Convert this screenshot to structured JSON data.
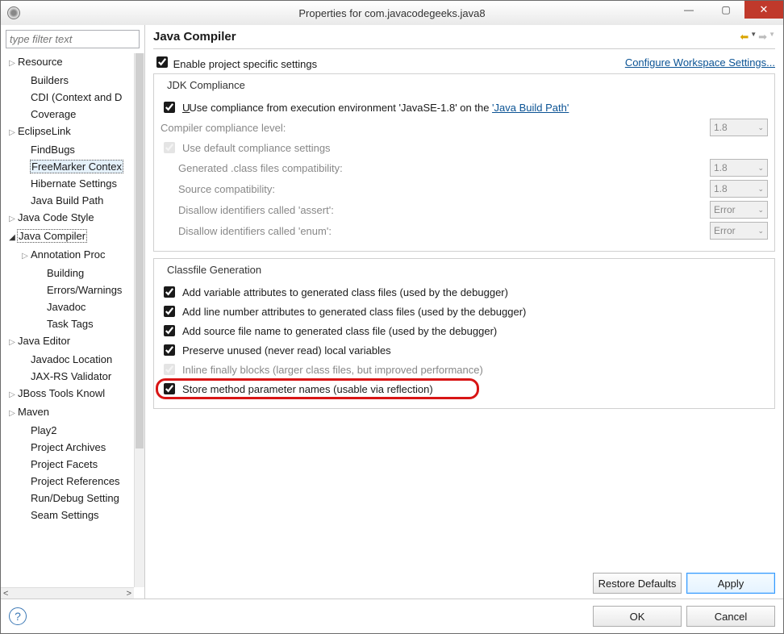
{
  "window": {
    "title": "Properties for com.javacodegeeks.java8"
  },
  "sidebar": {
    "filter_placeholder": "type filter text",
    "nodes": [
      {
        "label": "Resource",
        "depth": 0,
        "exp": ">"
      },
      {
        "label": "Builders",
        "depth": 1,
        "exp": ""
      },
      {
        "label": "CDI (Context and D",
        "depth": 1,
        "exp": ""
      },
      {
        "label": "Coverage",
        "depth": 1,
        "exp": ""
      },
      {
        "label": "EclipseLink",
        "depth": 0,
        "exp": ">"
      },
      {
        "label": "FindBugs",
        "depth": 1,
        "exp": ""
      },
      {
        "label": "FreeMarker Contex",
        "depth": 1,
        "exp": "",
        "selected": true
      },
      {
        "label": "Hibernate Settings",
        "depth": 1,
        "exp": ""
      },
      {
        "label": "Java Build Path",
        "depth": 1,
        "exp": ""
      },
      {
        "label": "Java Code Style",
        "depth": 0,
        "exp": ">"
      },
      {
        "label": "Java Compiler",
        "depth": 0,
        "exp": "⊿",
        "active": true
      },
      {
        "label": "Annotation Proc",
        "depth": 1,
        "exp": ">"
      },
      {
        "label": "Building",
        "depth": 2,
        "exp": ""
      },
      {
        "label": "Errors/Warnings",
        "depth": 2,
        "exp": ""
      },
      {
        "label": "Javadoc",
        "depth": 2,
        "exp": ""
      },
      {
        "label": "Task Tags",
        "depth": 2,
        "exp": ""
      },
      {
        "label": "Java Editor",
        "depth": 0,
        "exp": ">"
      },
      {
        "label": "Javadoc Location",
        "depth": 1,
        "exp": ""
      },
      {
        "label": "JAX-RS Validator",
        "depth": 1,
        "exp": ""
      },
      {
        "label": "JBoss Tools Knowl",
        "depth": 0,
        "exp": ">"
      },
      {
        "label": "Maven",
        "depth": 0,
        "exp": ">"
      },
      {
        "label": "Play2",
        "depth": 1,
        "exp": ""
      },
      {
        "label": "Project Archives",
        "depth": 1,
        "exp": ""
      },
      {
        "label": "Project Facets",
        "depth": 1,
        "exp": ""
      },
      {
        "label": "Project References",
        "depth": 1,
        "exp": ""
      },
      {
        "label": "Run/Debug Setting",
        "depth": 1,
        "exp": ""
      },
      {
        "label": "Seam Settings",
        "depth": 1,
        "exp": ""
      }
    ]
  },
  "page": {
    "title": "Java Compiler",
    "enable_label": "Enable project specific settings",
    "workspace_link": "Configure Workspace Settings...",
    "jdk": {
      "title": "JDK Compliance",
      "use_exec_pre": "Use compliance from execution environment 'JavaSE-1.8' on the ",
      "jbp_link": "'Java Build Path'",
      "compiler_level_label": "Compiler compliance level:",
      "use_default_label": "Use default compliance settings",
      "gen_class_label": "Generated .class files compatibility:",
      "source_compat_label": "Source compatibility:",
      "disallow_assert_label": "Disallow identifiers called 'assert':",
      "disallow_enum_label": "Disallow identifiers called 'enum':",
      "combo18": "1.8",
      "combo_err": "Error"
    },
    "classfile": {
      "title": "Classfile Generation",
      "r1": "Add variable attributes to generated class files (used by the debugger)",
      "r2": "Add line number attributes to generated class files (used by the debugger)",
      "r3": "Add source file name to generated class file (used by the debugger)",
      "r4": "Preserve unused (never read) local variables",
      "r5": "Inline finally blocks (larger class files, but improved performance)",
      "r6": "Store method parameter names (usable via reflection)"
    },
    "buttons": {
      "restore": "Restore Defaults",
      "apply": "Apply",
      "ok": "OK",
      "cancel": "Cancel"
    }
  }
}
